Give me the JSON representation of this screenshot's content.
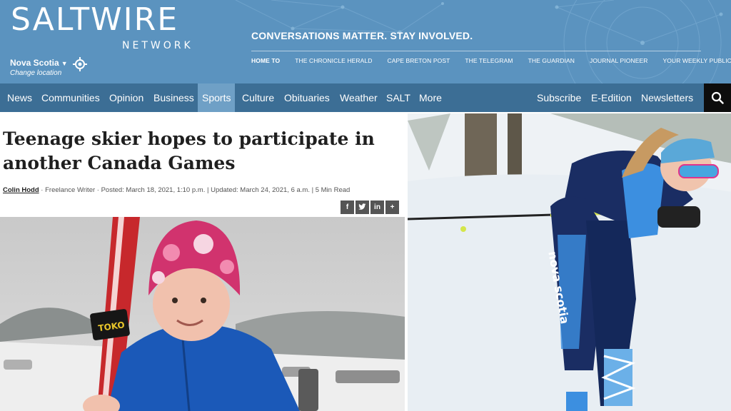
{
  "brand": {
    "logo_main": "SALTWIRE",
    "logo_sub": "NETWORK",
    "location": "Nova Scotia",
    "change_location": "Change location",
    "tagline": "CONVERSATIONS MATTER. STAY INVOLVED.",
    "color_band": "#5b93bf",
    "color_nav": "#3c6e95"
  },
  "sub_nav": [
    "HOME TO",
    "THE CHRONICLE HERALD",
    "CAPE BRETON POST",
    "THE TELEGRAM",
    "THE GUARDIAN",
    "JOURNAL PIONEER",
    "YOUR WEEKLY PUBLICATIONS"
  ],
  "main_nav": {
    "left": [
      "News",
      "Communities",
      "Opinion",
      "Business",
      "Sports",
      "Culture",
      "Obituaries",
      "Weather",
      "SALT",
      "More"
    ],
    "active": "Sports",
    "right": [
      "Subscribe",
      "E-Edition",
      "Newsletters"
    ],
    "search_icon": "search-icon"
  },
  "article": {
    "headline": "Teenage skier hopes to participate in another Canada Games",
    "author": "Colin Hodd",
    "byline_rest": " · Freelance Writer · Posted: March 18, 2021, 1:10 p.m. | Updated: March 24, 2021, 6 a.m. | 5 Min Read",
    "share": [
      "f",
      "t",
      "in",
      "+"
    ]
  },
  "photos": {
    "left_brand": "TOKO",
    "right_suit_text": "nova scotia"
  }
}
